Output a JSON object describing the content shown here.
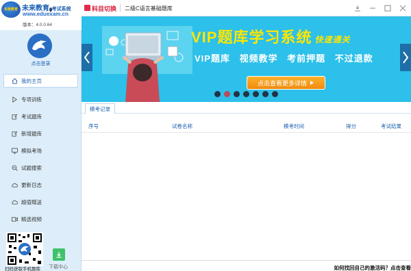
{
  "brand": {
    "name": "未来教育",
    "dot": "●",
    "system": "考试系统",
    "url": "www.eduexam.cn",
    "version": "版本：4.0.0.64",
    "logo_text": "未来教育"
  },
  "login": {
    "label": "点击登录"
  },
  "nav": {
    "items": [
      {
        "label": "我的主页",
        "icon": "home-icon"
      },
      {
        "label": "专项训练",
        "icon": "arrow-icon"
      },
      {
        "label": "考试题库",
        "icon": "edit-icon"
      },
      {
        "label": "新增题库",
        "icon": "edit-plus-icon"
      },
      {
        "label": "模拟考场",
        "icon": "monitor-icon"
      },
      {
        "label": "试题搜索",
        "icon": "search-icon"
      },
      {
        "label": "更新日志",
        "icon": "cloud-icon"
      },
      {
        "label": "超值赠送",
        "icon": "gift-cloud-icon"
      },
      {
        "label": "精选视频",
        "icon": "video-icon"
      }
    ]
  },
  "qr": {
    "label": "扫码获取手机题库"
  },
  "download": {
    "label": "下载中心"
  },
  "topbar": {
    "switch_label": "科目切换",
    "subject": "二级C语言基础题库"
  },
  "banner": {
    "title": "VIP题库学习系统",
    "subtitle": "快速通关",
    "features": "VIP题库 视频教学 考前押题 不过退款",
    "cta": "点击查看更多详情",
    "slide_count": 7,
    "active_slide": 2
  },
  "tabs": [
    {
      "label": "模考记录"
    }
  ],
  "table": {
    "columns": [
      "序号",
      "试卷名称",
      "模考时间",
      "得分",
      "考试结果"
    ],
    "rows": []
  },
  "footer": {
    "text": "如何找回自己的激活码？点击查看"
  },
  "colors": {
    "accent": "#1b5fb0",
    "sidebar_bg": "#ddeefa",
    "banner_bg": "#2cc0ea",
    "switch_red": "#d71e3a",
    "cta_orange": "#f08a10",
    "download_green": "#3ec26a"
  }
}
